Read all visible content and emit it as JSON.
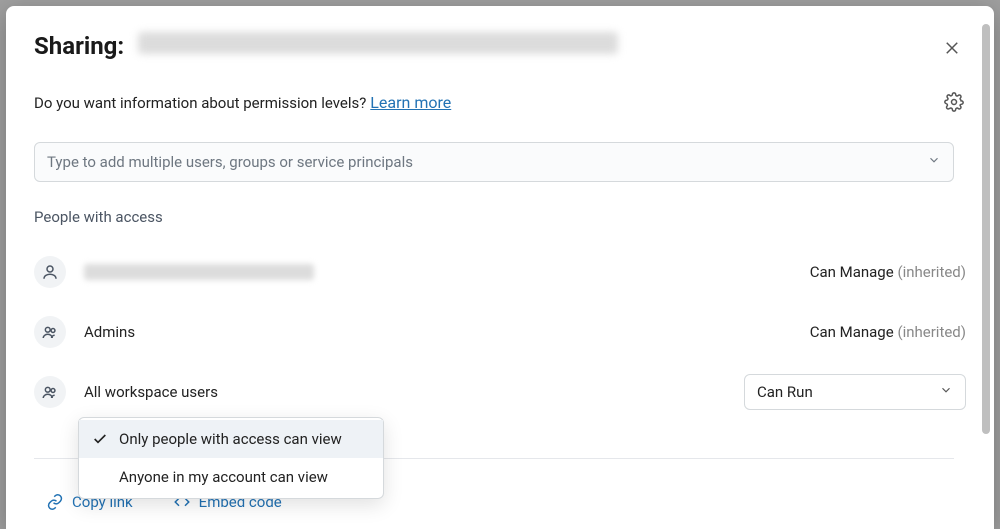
{
  "header": {
    "title_prefix": "Sharing:"
  },
  "info": {
    "text": "Do you want information about permission levels?",
    "link_label": "Learn more"
  },
  "add_input": {
    "placeholder": "Type to add multiple users, groups or service principals"
  },
  "section_label": "People with access",
  "access": [
    {
      "type": "user",
      "name": "",
      "permission": "Can Manage",
      "inherited": true,
      "editable": false
    },
    {
      "type": "group",
      "name": "Admins",
      "permission": "Can Manage",
      "inherited": true,
      "editable": false
    },
    {
      "type": "group",
      "name": "All workspace users",
      "permission": "Can Run",
      "inherited": false,
      "editable": true
    }
  ],
  "perm_select": {
    "value": "Can Run"
  },
  "view_scope": {
    "options": [
      "Only people with access can view",
      "Anyone in my account can view"
    ],
    "selected_index": 0
  },
  "footer": {
    "copy_link": "Copy link",
    "embed_code": "Embed code"
  }
}
